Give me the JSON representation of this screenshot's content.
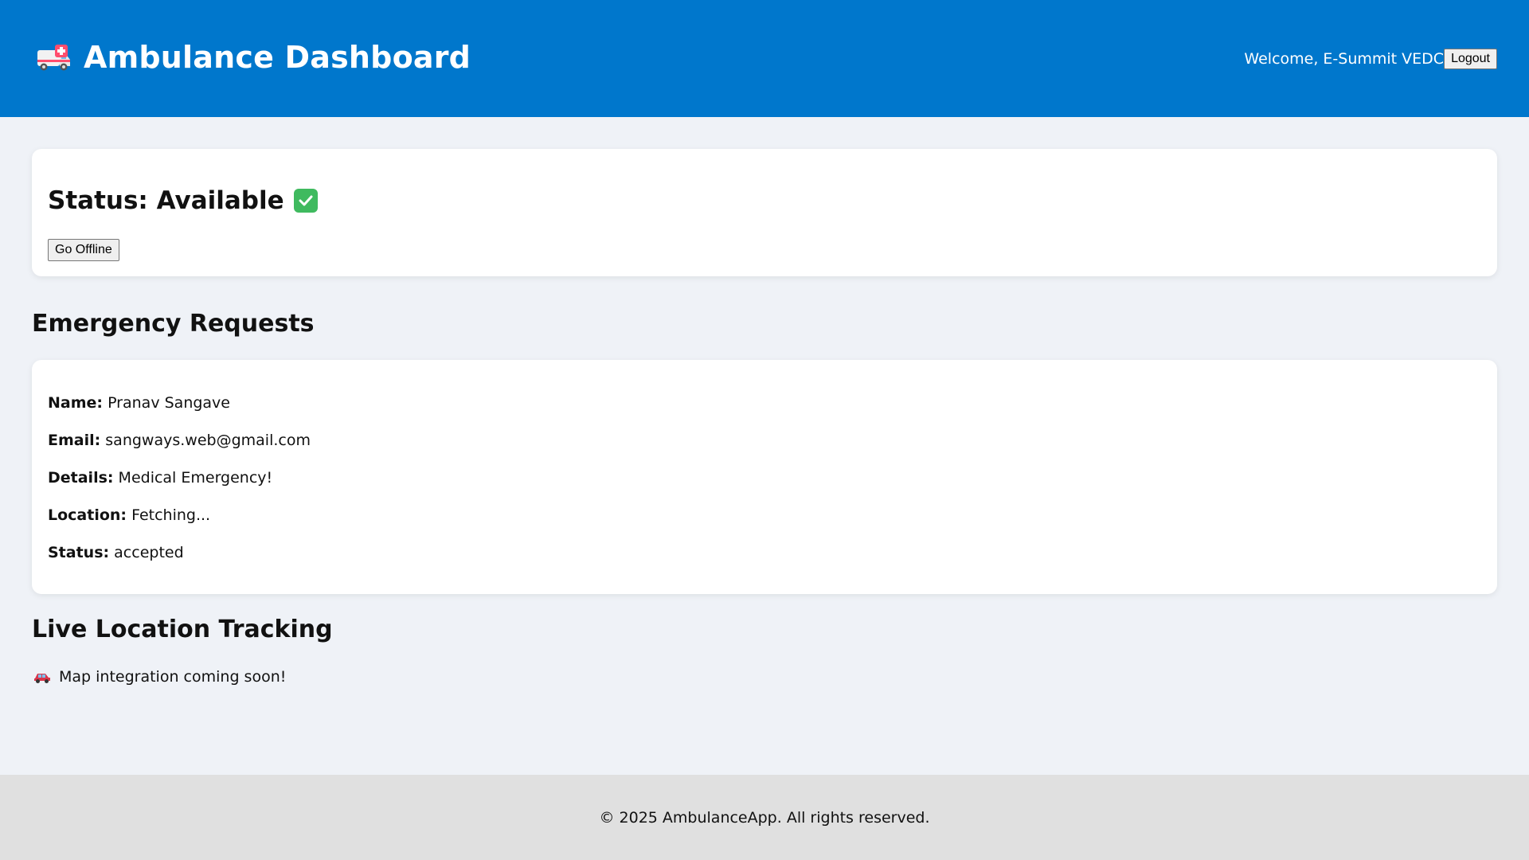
{
  "header": {
    "title": "Ambulance Dashboard",
    "welcome": "Welcome, E-Summit VEDC",
    "logout_label": "Logout",
    "brand_icon": "ambulance-icon",
    "bg_color": "#0077cc"
  },
  "status": {
    "label": "Status: Available",
    "icon": "check-mark-icon",
    "toggle_label": "Go Offline"
  },
  "requests": {
    "heading": "Emergency Requests",
    "items": [
      {
        "name_label": "Name:",
        "name": "Pranav Sangave",
        "email_label": "Email:",
        "email": "sangways.web@gmail.com",
        "details_label": "Details:",
        "details": "Medical Emergency!",
        "location_label": "Location:",
        "location": "Fetching...",
        "status_label": "Status:",
        "status": "accepted"
      }
    ]
  },
  "tracking": {
    "heading": "Live Location Tracking",
    "icon": "car-icon",
    "note": "Map integration coming soon!"
  },
  "footer": {
    "text": "© 2025 AmbulanceApp. All rights reserved."
  }
}
